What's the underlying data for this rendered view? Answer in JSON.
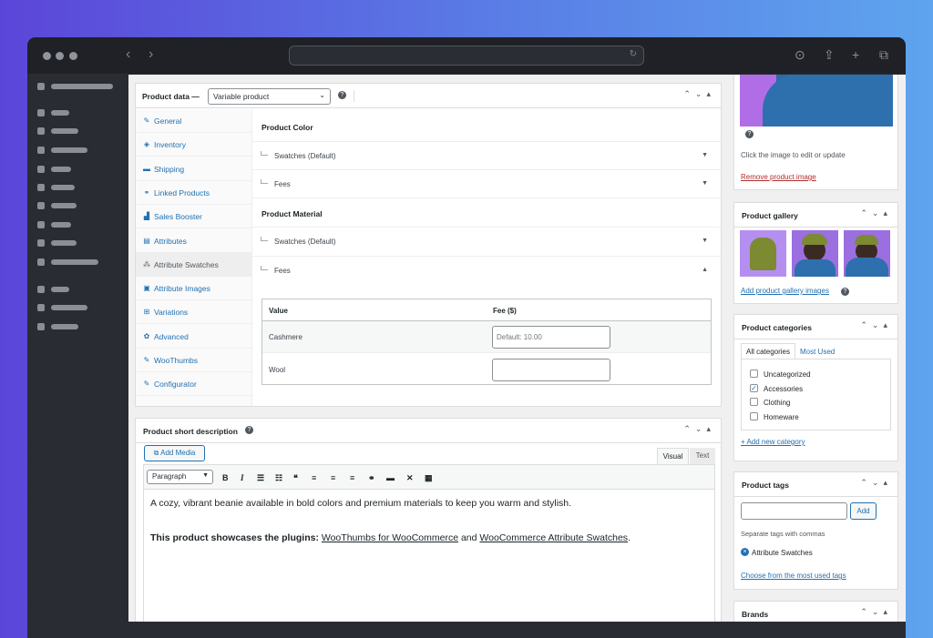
{
  "product_data": {
    "title": "Product data —",
    "type_value": "Variable product",
    "tabs": [
      {
        "label": "General",
        "icon": "✎"
      },
      {
        "label": "Inventory",
        "icon": "◈"
      },
      {
        "label": "Shipping",
        "icon": "▬"
      },
      {
        "label": "Linked Products",
        "icon": "⚭"
      },
      {
        "label": "Sales Booster",
        "icon": "▟"
      },
      {
        "label": "Attributes",
        "icon": "▤"
      },
      {
        "label": "Attribute Swatches",
        "icon": "⁂"
      },
      {
        "label": "Attribute Images",
        "icon": "▣"
      },
      {
        "label": "Variations",
        "icon": "⊞"
      },
      {
        "label": "Advanced",
        "icon": "✿"
      },
      {
        "label": "WooThumbs",
        "icon": "✎"
      },
      {
        "label": "Configurator",
        "icon": "✎"
      }
    ],
    "sections": [
      {
        "title": "Product Color",
        "rows": [
          "Swatches (Default)",
          "Fees"
        ]
      },
      {
        "title": "Product Material",
        "rows": [
          "Swatches (Default)",
          "Fees"
        ]
      }
    ],
    "fee_table": {
      "col_value": "Value",
      "col_fee": "Fee ($)",
      "rows": [
        {
          "value": "Cashmere",
          "fee_placeholder": "Default: 10.00"
        },
        {
          "value": "Wool",
          "fee_placeholder": ""
        }
      ]
    }
  },
  "short_desc": {
    "title": "Product short description",
    "add_media": "Add Media",
    "tab_visual": "Visual",
    "tab_text": "Text",
    "format": "Paragraph",
    "line1": "A cozy, vibrant beanie available in bold colors and premium materials to keep you warm and stylish.",
    "bold": "This product showcases the plugins:",
    "link1": "WooThumbs for WooCommerce",
    "and": "and",
    "link2": "WooCommerce Attribute Swatches",
    "end": "."
  },
  "product_image": {
    "help": "Click the image to edit or update",
    "remove": "Remove product image"
  },
  "gallery": {
    "title": "Product gallery",
    "add": "Add product gallery images"
  },
  "categories": {
    "title": "Product categories",
    "tab_all": "All categories",
    "tab_used": "Most Used",
    "items": [
      {
        "label": "Uncategorized",
        "checked": false
      },
      {
        "label": "Accessories",
        "checked": true
      },
      {
        "label": "Clothing",
        "checked": false
      },
      {
        "label": "Homeware",
        "checked": false
      }
    ],
    "add": "+ Add new category"
  },
  "tags": {
    "title": "Product tags",
    "add_btn": "Add",
    "hint": "Separate tags with commas",
    "tag": "Attribute Swatches",
    "choose": "Choose from the most used tags"
  },
  "brands": {
    "title": "Brands"
  },
  "colors": {
    "accent": "#2271b1",
    "remove": "#b32d2e",
    "gradient_start": "#5b46d9",
    "gradient_end": "#5ea4ee",
    "window": "#2a2c33"
  }
}
